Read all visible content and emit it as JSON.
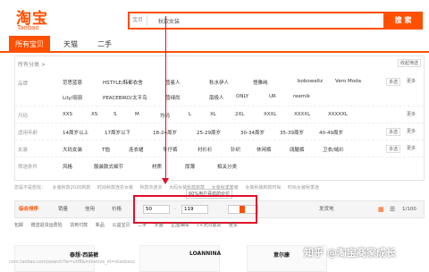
{
  "header": {
    "logo_cn": "淘宝",
    "logo_en": "Taobao",
    "search_scope": "宝贝",
    "search_value": "秋款女装",
    "search_button": "搜 索"
  },
  "tabs": [
    {
      "label": "所有宝贝",
      "active": true
    },
    {
      "label": "天猫",
      "active": false
    },
    {
      "label": "二手",
      "active": false
    }
  ],
  "category_nav": {
    "label": "所有分类 >",
    "collapse": "收起筛选"
  },
  "filters": [
    {
      "label": "品牌",
      "options": [
        "范思蓝恩",
        "HSTYLE/韩都衣舍",
        "茵曼人",
        "秋水伊人",
        "悟雅纯",
        "bobowaltz",
        "Vero Moda",
        "Lily/丽丽",
        "PEACEBIRD/太平鸟",
        "茵绿尚",
        "南极人",
        "ONLY",
        "UR",
        "reemik"
      ],
      "multi": "多选",
      "more": "更多"
    },
    {
      "label": "尺码",
      "options": [
        "XXS",
        "XS",
        "S",
        "M",
        "均码",
        "L",
        "XL",
        "2XL",
        "XXXL",
        "XXXXL",
        "XXXXXL"
      ],
      "more": "更多"
    },
    {
      "label": "适用年龄",
      "options": [
        "14周岁以上",
        "17周岁以下",
        "18-24周岁",
        "25-29周岁",
        "30-34周岁",
        "35-39周岁",
        "40-49周岁"
      ],
      "multi": "多选",
      "more": "更多"
    },
    {
      "label": "女装",
      "options": [
        "大码女装",
        "T恤",
        "连衣裙",
        "牛仔裤",
        "衬衫衫",
        "针织",
        "休闲裤",
        "阔腿裤",
        "卫衣/绒衫"
      ],
      "multi": "多选",
      "more": "更多"
    },
    {
      "label": "筛选条件",
      "options": [
        "风格",
        "服装款式细节",
        "材质",
        "厚薄",
        "相关分类"
      ]
    }
  ],
  "guess": {
    "label": "您是不是想找：",
    "items": [
      "女装秋款2020新款",
      "时尚秋款连衣女装",
      "秋款衣连衣",
      "大码女装秋款新款",
      "女装秋季套装",
      "女装秋装新款时尚",
      "时尚女装秋季连"
    ]
  },
  "sortbar": {
    "items": [
      "综合排序",
      "销量",
      "信用",
      "价格"
    ],
    "price_min": "50",
    "price_max": "119",
    "tooltip": "60%用户喜欢的价位",
    "ship_from": "发货地",
    "page": "1/100"
  },
  "options": [
    "包邮",
    "赠送退货运费险",
    "货到付款",
    "新品",
    "公益宝贝",
    "二手",
    "天猫",
    "正品保障",
    "7+天内退货",
    "更多"
  ],
  "products": [
    "泰想·西装裤",
    "LOANNINA",
    "意尔康"
  ],
  "footer": {
    "url": "com.taobao.com/search?ie=utf8&initiative_id=staobaoz"
  },
  "watermark": "知乎 @淘宝商家成长",
  "colors": {
    "accent": "#ff5000",
    "highlight": "#e0102a"
  }
}
